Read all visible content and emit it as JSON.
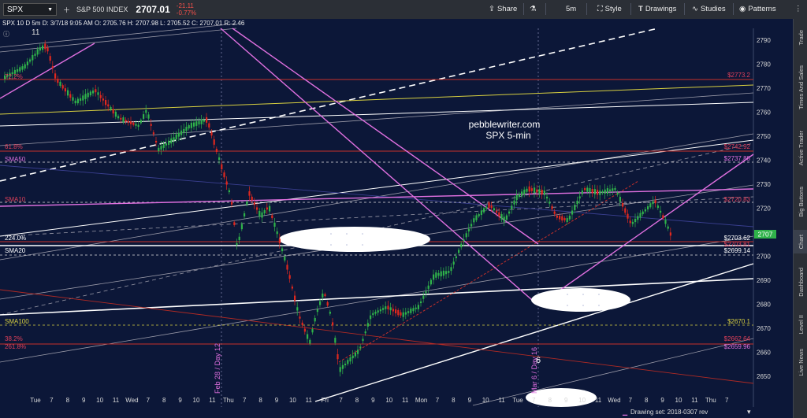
{
  "toolbar": {
    "symbol": "SPX",
    "index_name": "S&P 500 INDEX",
    "last_price": "2707.01",
    "change": "-21.11",
    "change_pct": "-0.77%",
    "share_label": "Share",
    "timeframe_label": "5m",
    "style_label": "Style",
    "drawings_label": "Drawings",
    "studies_label": "Studies",
    "patterns_label": "Patterns"
  },
  "subheader": {
    "text": "SPX 10 D 5m   D: 3/7/18 9:05 AM  O: 2705.76  H: 2707.98  L: 2705.52  C: 2707.01  R: 2.46",
    "marker": "11"
  },
  "watermark": {
    "line1": "pebblewriter.com",
    "line2": "SPX 5-min"
  },
  "levels": {
    "pct_72": "72.2%",
    "lvl_2773": "$2773.2",
    "fib_618": "61.8%",
    "lvl_2742": "$2742.92",
    "sma50": "SMA50",
    "lvl_2737": "$2737.88",
    "sma10": "SMA10",
    "lvl_2720": "$2720.83",
    "pct_224": "224.0%",
    "lvl_2703": "$2703.62",
    "lvl_2703b": "$2703.81",
    "sma20": "SMA20",
    "lvl_2699": "$2699.14",
    "sma100": "SMA100",
    "lvl_2670": "$2670.1",
    "fib_382": "38.2%",
    "lvl_2662": "$2662.64",
    "fib_2618": "261.8%",
    "lvl_2659": "$2659.96",
    "price_tag": "2707"
  },
  "annotations": {
    "feb28": "Feb 28 / Day 12",
    "mar6": "Mar 6 / Day 16",
    "num_6": "6"
  },
  "y_axis": [
    "2790",
    "2780",
    "2770",
    "2760",
    "2750",
    "2740",
    "2730",
    "2720",
    "2710",
    "2700",
    "2690",
    "2680",
    "2670",
    "2660",
    "2650"
  ],
  "x_axis": [
    "Tue",
    "7",
    "8",
    "9",
    "10",
    "11",
    "Wed",
    "7",
    "8",
    "9",
    "10",
    "11",
    "Thu",
    "7",
    "8",
    "9",
    "10",
    "11",
    "Fri",
    "7",
    "8",
    "9",
    "10",
    "11",
    "Mon",
    "7",
    "8",
    "9",
    "10",
    "11",
    "Tue",
    "7",
    "8",
    "9",
    "10",
    "11",
    "Wed",
    "7",
    "8",
    "9",
    "10",
    "11",
    "Thu",
    "7"
  ],
  "footer": {
    "drawing_set": "Drawing set: 2018-0307 rev"
  },
  "sidebar": [
    "Trade",
    "Times And Sales",
    "Active Trader",
    "Big Buttons",
    "Chart",
    "Dashboard",
    "Level II",
    "Live News"
  ],
  "colors": {
    "background": "#0c1738",
    "up": "#2fb24a",
    "down": "#e0281e",
    "magenta": "#e070e0",
    "red_level": "#c8302a",
    "yellow": "#d8d040"
  }
}
